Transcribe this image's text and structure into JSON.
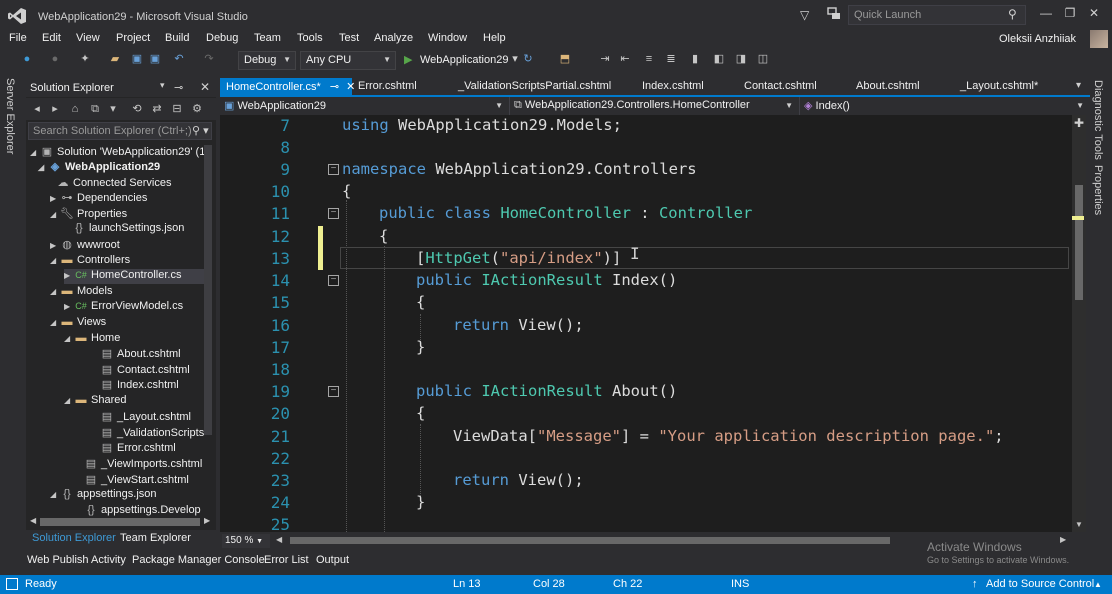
{
  "window": {
    "title": "WebApplication29 - Microsoft Visual Studio",
    "quick_launch_placeholder": "Quick Launch",
    "user": "Oleksii Anzhiiak"
  },
  "menu": [
    "File",
    "Edit",
    "View",
    "Project",
    "Build",
    "Debug",
    "Team",
    "Tools",
    "Test",
    "Analyze",
    "Window",
    "Help"
  ],
  "toolbar": {
    "configuration": "Debug",
    "platform": "Any CPU",
    "run_target": "WebApplication29"
  },
  "server_explorer_label": "Server Explorer",
  "solution_explorer": {
    "title": "Solution Explorer",
    "search_placeholder": "Search Solution Explorer (Ctrl+;)",
    "items": [
      {
        "label": "Solution 'WebApplication29' (1",
        "icon": "solution-icon"
      },
      {
        "label": "WebApplication29",
        "icon": "web-project-icon",
        "bold": true
      },
      {
        "label": "Connected Services",
        "icon": "connected-services-icon"
      },
      {
        "label": "Dependencies",
        "icon": "dependencies-icon"
      },
      {
        "label": "Properties",
        "icon": "wrench-icon"
      },
      {
        "label": "launchSettings.json",
        "icon": "json-file-icon"
      },
      {
        "label": "wwwroot",
        "icon": "globe-icon"
      },
      {
        "label": "Controllers",
        "icon": "folder-icon"
      },
      {
        "label": "HomeController.cs",
        "icon": "csharp-file-icon"
      },
      {
        "label": "Models",
        "icon": "folder-icon"
      },
      {
        "label": "ErrorViewModel.cs",
        "icon": "csharp-file-icon"
      },
      {
        "label": "Views",
        "icon": "folder-icon"
      },
      {
        "label": "Home",
        "icon": "folder-icon"
      },
      {
        "label": "About.cshtml",
        "icon": "cshtml-file-icon"
      },
      {
        "label": "Contact.cshtml",
        "icon": "cshtml-file-icon"
      },
      {
        "label": "Index.cshtml",
        "icon": "cshtml-file-icon"
      },
      {
        "label": "Shared",
        "icon": "folder-icon"
      },
      {
        "label": "_Layout.cshtml",
        "icon": "cshtml-file-icon"
      },
      {
        "label": "_ValidationScripts",
        "icon": "cshtml-file-icon"
      },
      {
        "label": "Error.cshtml",
        "icon": "cshtml-file-icon"
      },
      {
        "label": "_ViewImports.cshtml",
        "icon": "cshtml-file-icon"
      },
      {
        "label": "_ViewStart.cshtml",
        "icon": "cshtml-file-icon"
      },
      {
        "label": "appsettings.json",
        "icon": "json-file-icon"
      },
      {
        "label": "appsettings.Develop",
        "icon": "json-file-icon"
      }
    ],
    "tabs": [
      "Solution Explorer",
      "Team Explorer"
    ]
  },
  "editor": {
    "tabs": [
      "HomeController.cs*",
      "Error.cshtml",
      "_ValidationScriptsPartial.cshtml",
      "Index.cshtml",
      "Contact.cshtml",
      "About.cshtml",
      "_Layout.cshtml*"
    ],
    "nav": {
      "project": "WebApplication29",
      "class": "WebApplication29.Controllers.HomeController",
      "member": "Index()"
    },
    "line_numbers": [
      "7",
      "8",
      "9",
      "10",
      "11",
      "12",
      "13",
      "14",
      "15",
      "16",
      "17",
      "18",
      "19",
      "20",
      "21",
      "22",
      "23",
      "24",
      "25"
    ],
    "code": {
      "l7_kw": "using",
      "l7_rest": " WebApplication29.Models;",
      "l9_kw": "namespace",
      "l9_rest": " WebApplication29.Controllers",
      "brace_open": "{",
      "brace_close": "}",
      "l11_kw": "public class",
      "l11_name": " HomeController",
      "l11_colon": " : ",
      "l11_base": "Controller",
      "l13_open": "[",
      "l13_attr": "HttpGet",
      "l13_paren": "(",
      "l13_str": "\"api/index\"",
      "l13_close": ")]",
      "l14_kw": "public",
      "l14_type": " IActionResult",
      "l14_name": " Index()",
      "l16_kw": "return",
      "l16_rest": " View();",
      "l19_kw": "public",
      "l19_type": " IActionResult",
      "l19_name": " About()",
      "l21_a": "ViewData[",
      "l21_key": "\"Message\"",
      "l21_b": "] = ",
      "l21_val": "\"Your application description page.\"",
      "l21_c": ";",
      "l23_kw": "return",
      "l23_rest": " View();"
    },
    "zoom": "150 %"
  },
  "right_strip": [
    "Diagnostic Tools",
    "Properties"
  ],
  "tool_tabs": [
    "Web Publish Activity",
    "Package Manager Console",
    "Error List",
    "Output"
  ],
  "watermark": {
    "title": "Activate Windows",
    "subtitle": "Go to Settings to activate Windows."
  },
  "status": {
    "state": "Ready",
    "line": "Ln 13",
    "col": "Col 28",
    "ch": "Ch 22",
    "mode": "INS",
    "source_control": "Add to Source Control"
  },
  "colors": {
    "accent": "#007acc",
    "keyword": "#569cd6",
    "type": "#4ec9b0",
    "string": "#d69d85",
    "line_number": "#2b91af"
  }
}
